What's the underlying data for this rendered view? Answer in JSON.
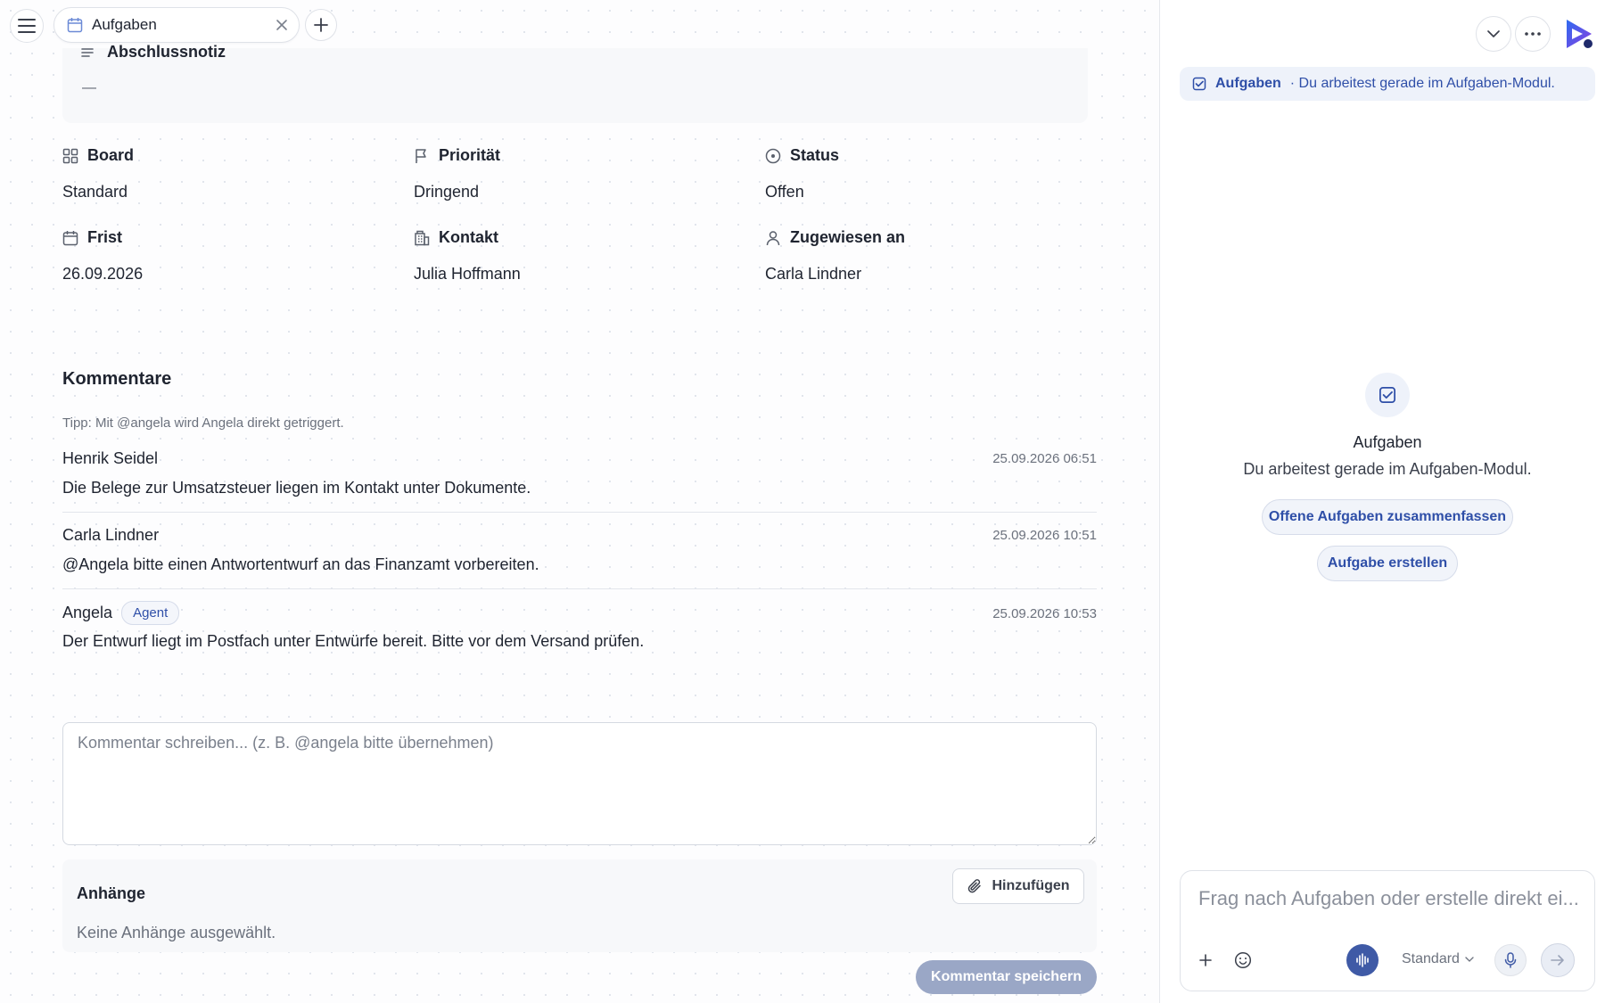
{
  "tabs": [
    {
      "label": "Aufgaben",
      "icon": "calendar-icon"
    }
  ],
  "task": {
    "closing_note_label": "Abschlussnotiz",
    "closing_note_value": "—",
    "fields": {
      "board": {
        "label": "Board",
        "value": "Standard",
        "icon": "grid-icon"
      },
      "priority": {
        "label": "Priorität",
        "value": "Dringend",
        "icon": "flag-icon"
      },
      "status": {
        "label": "Status",
        "value": "Offen",
        "icon": "status-circle-icon"
      },
      "due": {
        "label": "Frist",
        "value": "26.09.2026",
        "icon": "calendar-icon"
      },
      "contact": {
        "label": "Kontakt",
        "value": "Julia Hoffmann",
        "icon": "building-icon"
      },
      "assignee": {
        "label": "Zugewiesen an",
        "value": "Carla Lindner",
        "icon": "user-icon"
      }
    }
  },
  "comments": {
    "title": "Kommentare",
    "tip": "Tipp: Mit @angela wird Angela direkt getriggert.",
    "items": [
      {
        "author": "Henrik Seidel",
        "time": "25.09.2026 06:51",
        "text": "Die Belege zur Umsatzsteuer liegen im Kontakt unter Dokumente."
      },
      {
        "author": "Carla Lindner",
        "time": "25.09.2026 10:51",
        "text": "@Angela bitte einen Antwortentwurf an das Finanzamt vorbereiten."
      },
      {
        "author": "Angela",
        "badge": "Agent",
        "time": "25.09.2026 10:53",
        "text": "Der Entwurf liegt im Postfach unter Entwürfe bereit. Bitte vor dem Versand prüfen."
      }
    ],
    "input_placeholder": "Kommentar schreiben... (z. B. @angela bitte übernehmen)",
    "attachments_title": "Anhänge",
    "attachments_add": "Hinzufügen",
    "attachments_empty": "Keine Anhänge ausgewählt.",
    "save_label": "Kommentar speichern"
  },
  "assistant": {
    "context_title": "Aufgaben",
    "context_sub": "· Du arbeitest gerade im Aufgaben-Modul.",
    "empty_title": "Aufgaben",
    "empty_sub": "Du arbeitest gerade im Aufgaben-Modul.",
    "suggestions": [
      "Offene Aufgaben zusammenfassen",
      "Aufgabe erstellen"
    ],
    "input_placeholder": "Frag nach Aufgaben oder erstelle direkt ei...",
    "model": "Standard"
  },
  "colors": {
    "accent": "#2f4fa8",
    "accent_soft": "#eef2fa",
    "save_disabled": "#9aa7c6"
  }
}
